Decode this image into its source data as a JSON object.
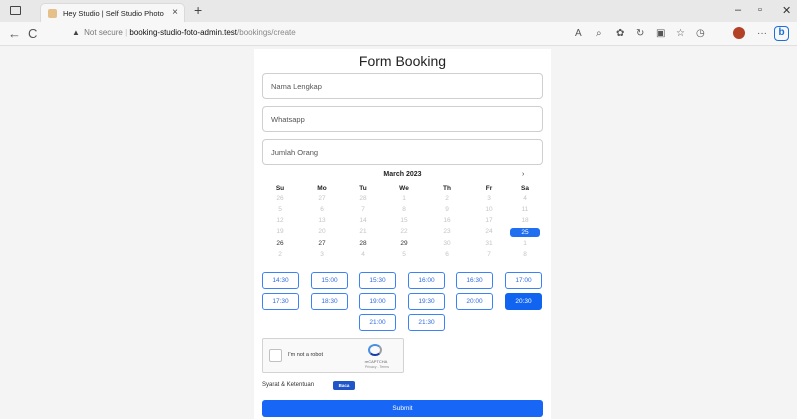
{
  "browser": {
    "tab_title": "Hey Studio | Self Studio Photo",
    "tab_close": "×",
    "new_tab": "+",
    "url_security": "Not secure",
    "url_host": "booking-studio-foto-admin.test",
    "url_path": "/bookings/create",
    "win_minimize": "–",
    "win_restore": "▫",
    "win_close": "✕",
    "reader_label": "A",
    "back": "←",
    "refresh": "C",
    "more": "···",
    "bing": "b"
  },
  "form": {
    "title": "Form Booking",
    "name_placeholder": "Nama Lengkap",
    "whatsapp_placeholder": "Whatsapp",
    "people_placeholder": "Jumlah Orang"
  },
  "calendar": {
    "month": "March 2023",
    "next_arrow": "›",
    "weekdays": [
      "Su",
      "Mo",
      "Tu",
      "We",
      "Th",
      "Fr",
      "Sa"
    ],
    "weeks": [
      [
        "26",
        "27",
        "28",
        "1",
        "2",
        "3",
        "4"
      ],
      [
        "5",
        "6",
        "7",
        "8",
        "9",
        "10",
        "11"
      ],
      [
        "12",
        "13",
        "14",
        "15",
        "16",
        "17",
        "18"
      ],
      [
        "19",
        "20",
        "21",
        "22",
        "23",
        "24",
        "25"
      ],
      [
        "26",
        "27",
        "28",
        "29",
        "30",
        "31",
        "1"
      ],
      [
        "2",
        "3",
        "4",
        "5",
        "6",
        "7",
        "8"
      ]
    ],
    "selected": "25"
  },
  "time_slots": [
    [
      "14:30",
      "15:00",
      "15:30",
      "16:00",
      "16:30",
      "17:00"
    ],
    [
      "17:30",
      "18:30",
      "19:00",
      "19:30",
      "20:00",
      "20:30"
    ],
    [
      "21:00",
      "21:30"
    ]
  ],
  "selected_slot": "20:30",
  "captcha": {
    "label": "I'm not a robot",
    "brand": "reCAPTCHA",
    "links": "Privacy - Terms"
  },
  "terms": {
    "label": "Syarat & Ketentuan",
    "badge": "Baca"
  },
  "submit_label": "Submit",
  "colors": {
    "accent": "#1766f5",
    "selected": "#1f6ff0"
  }
}
